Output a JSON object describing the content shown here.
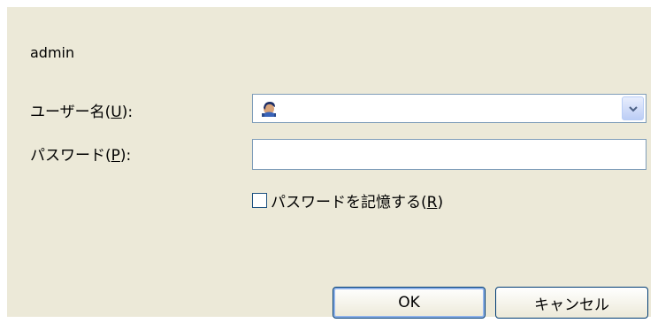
{
  "server": "admin",
  "username": {
    "label": "ユーザー名(",
    "mnemonic": "U",
    "suffix": "):",
    "value": ""
  },
  "password": {
    "label": "パスワード(",
    "mnemonic": "P",
    "suffix": "):",
    "value": ""
  },
  "remember": {
    "label": "パスワードを記憶する(",
    "mnemonic": "R",
    "suffix": ")",
    "checked": false
  },
  "buttons": {
    "ok": "OK",
    "cancel": "キャンセル"
  },
  "icons": {
    "user": "user-icon",
    "dropdown": "chevron-down-icon"
  },
  "colors": {
    "dialog_bg": "#ece9d8",
    "field_border": "#7f9db9",
    "button_border": "#003c74"
  }
}
